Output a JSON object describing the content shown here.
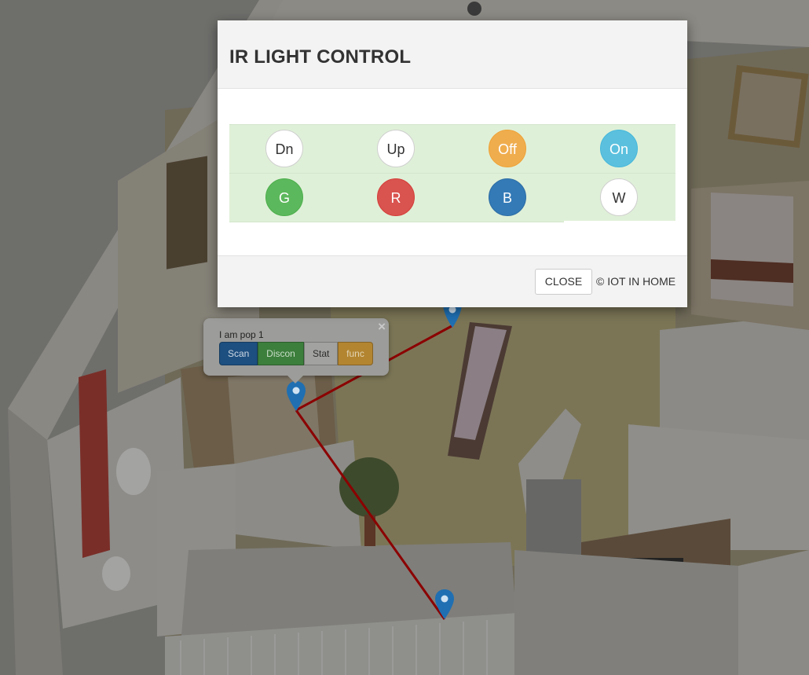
{
  "modal": {
    "title": "IR LIGHT CONTROL",
    "buttons": [
      {
        "label": "Dn",
        "style": "default"
      },
      {
        "label": "Up",
        "style": "default"
      },
      {
        "label": "Off",
        "style": "warning"
      },
      {
        "label": "On",
        "style": "info"
      },
      {
        "label": "G",
        "style": "success"
      },
      {
        "label": "R",
        "style": "danger"
      },
      {
        "label": "B",
        "style": "primary"
      },
      {
        "label": "W",
        "style": "default"
      }
    ],
    "close_label": "CLOSE",
    "copyright": "© IOT IN HOME"
  },
  "popover": {
    "title": "I am pop 1",
    "close_glyph": "×",
    "buttons": [
      {
        "label": "Scan"
      },
      {
        "label": "Discon"
      },
      {
        "label": "Stat"
      },
      {
        "label": "func"
      }
    ]
  },
  "colors": {
    "row_background": "#dff0d8",
    "warning": "#f0ad4e",
    "info": "#5bc0de",
    "success": "#5cb85c",
    "danger": "#d9534f",
    "primary": "#337ab7",
    "connection_line": "#8b0000",
    "map_pin": "#1f6fb2"
  }
}
